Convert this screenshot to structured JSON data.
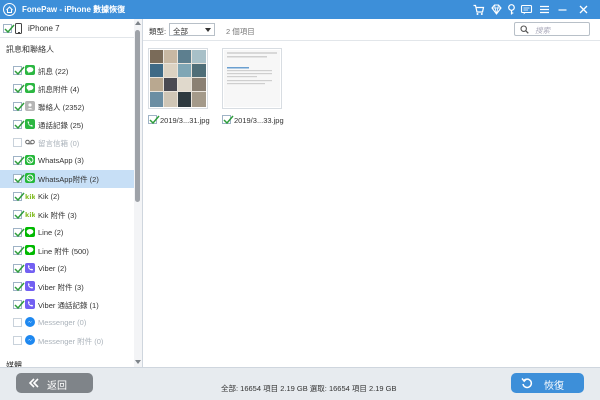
{
  "app": {
    "title": "FonePaw - iPhone 數據恢復"
  },
  "sidebar": {
    "device_label": "iPhone 7",
    "section_messages": "訊息和聯絡人",
    "section_media": "媒體",
    "categories": [
      {
        "label": "訊息 (22)",
        "checked": true,
        "icon": "messages-icon",
        "color": "#2cb742"
      },
      {
        "label": "訊息附件 (4)",
        "checked": true,
        "icon": "message-attachments-icon",
        "color": "#2cb742"
      },
      {
        "label": "聯絡人 (2352)",
        "checked": true,
        "icon": "contacts-icon",
        "color": "#b5b5b5"
      },
      {
        "label": "通話記錄 (25)",
        "checked": true,
        "icon": "call-history-icon",
        "color": "#2cb742"
      },
      {
        "label": "留言信箱 (0)",
        "checked": false,
        "icon": "voicemail-icon",
        "color": "#666666"
      },
      {
        "label": "WhatsApp (3)",
        "checked": true,
        "icon": "whatsapp-icon",
        "color": "#25b83a"
      },
      {
        "label": "WhatsApp附件 (2)",
        "checked": true,
        "icon": "whatsapp-attachments-icon",
        "color": "#25b83a",
        "selected": true
      },
      {
        "label": "Kik (2)",
        "checked": true,
        "icon": "kik-icon",
        "color": "#82bc23"
      },
      {
        "label": "Kik 附件 (3)",
        "checked": true,
        "icon": "kik-attachments-icon",
        "color": "#82bc23"
      },
      {
        "label": "Line (2)",
        "checked": true,
        "icon": "line-icon",
        "color": "#00b900"
      },
      {
        "label": "Line 附件 (500)",
        "checked": true,
        "icon": "line-attachments-icon",
        "color": "#00b900"
      },
      {
        "label": "Viber (2)",
        "checked": true,
        "icon": "viber-icon",
        "color": "#7360f2"
      },
      {
        "label": "Viber 附件 (3)",
        "checked": true,
        "icon": "viber-attachments-icon",
        "color": "#7360f2"
      },
      {
        "label": "Viber 通話記錄 (1)",
        "checked": true,
        "icon": "viber-call-history-icon",
        "color": "#7360f2"
      },
      {
        "label": "Messenger (0)",
        "checked": false,
        "icon": "messenger-icon",
        "color": "#1e88f0"
      },
      {
        "label": "Messenger 附件 (0)",
        "checked": false,
        "icon": "messenger-attachments-icon",
        "color": "#1e88f0"
      }
    ]
  },
  "toolbar": {
    "type_label": "類型:",
    "type_value": "全部",
    "item_count": "2 個項目",
    "search_placeholder": "搜索"
  },
  "files": [
    {
      "name": "2019/3...31.jpg",
      "checked": true
    },
    {
      "name": "2019/3...33.jpg",
      "checked": true
    }
  ],
  "bottom": {
    "back_label": "返回",
    "summary": "全部: 16654 項目 2.19 GB 選取: 16654 項目 2.19 GB",
    "recover_label": "恢復"
  },
  "colors": {
    "accent": "#3d8fd9",
    "selected_row": "#c7dff6",
    "back_button": "#7f8489"
  }
}
